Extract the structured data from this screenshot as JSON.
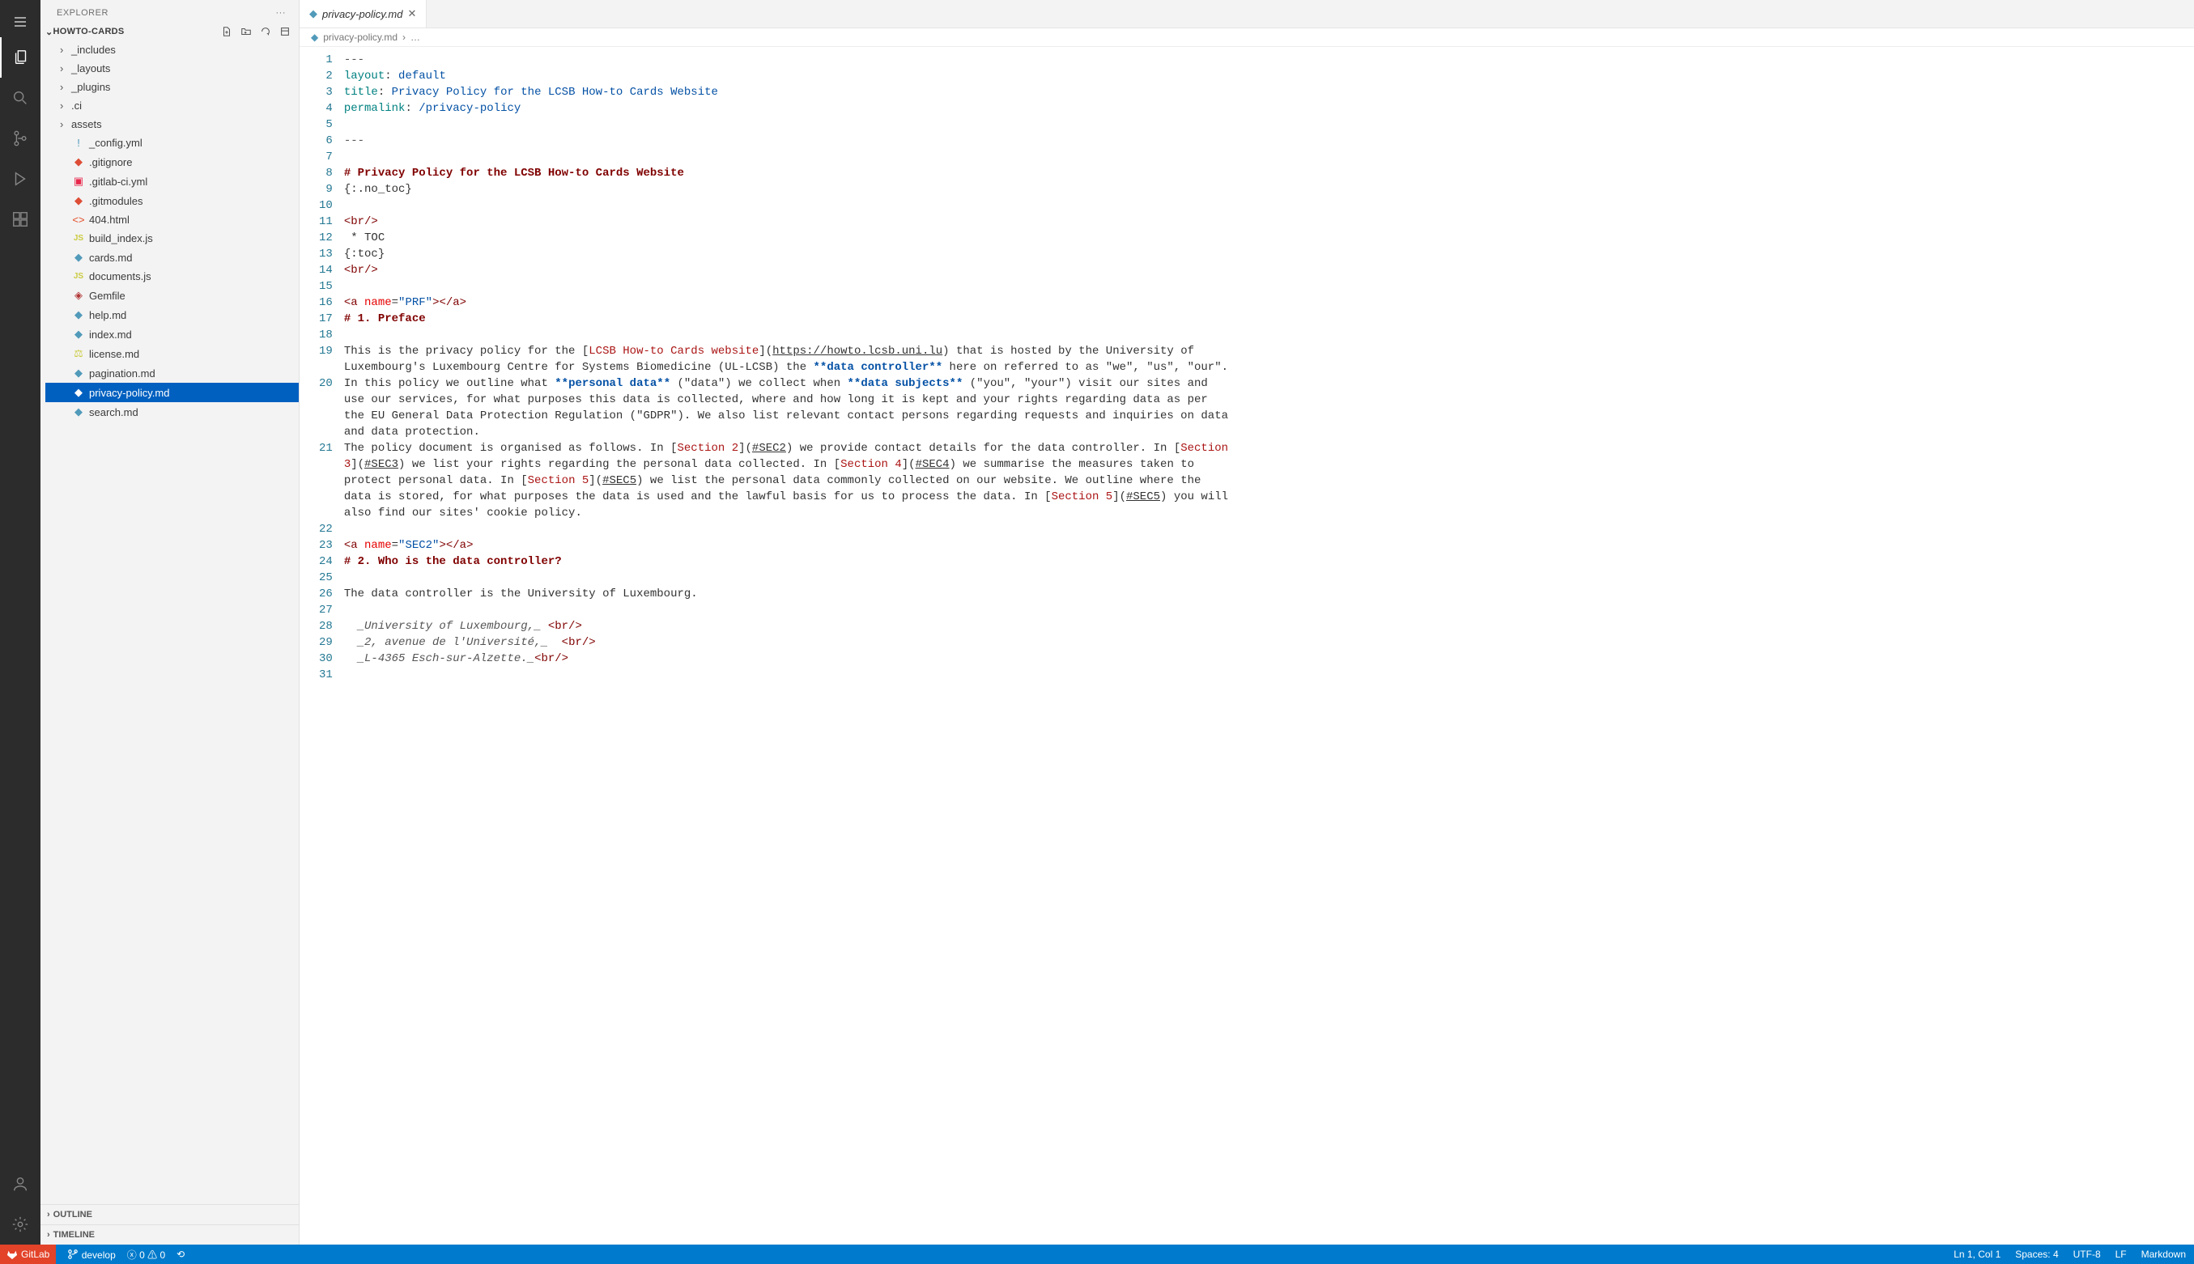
{
  "sidebar": {
    "title": "EXPLORER",
    "project": "HOWTO-CARDS",
    "folders": [
      "_includes",
      "_layouts",
      "_plugins",
      ".ci",
      "assets"
    ],
    "files": [
      {
        "name": "_config.yml",
        "icon": "exc"
      },
      {
        "name": ".gitignore",
        "icon": "git"
      },
      {
        "name": ".gitlab-ci.yml",
        "icon": "yml"
      },
      {
        "name": ".gitmodules",
        "icon": "git"
      },
      {
        "name": "404.html",
        "icon": "html"
      },
      {
        "name": "build_index.js",
        "icon": "js"
      },
      {
        "name": "cards.md",
        "icon": "md"
      },
      {
        "name": "documents.js",
        "icon": "js"
      },
      {
        "name": "Gemfile",
        "icon": "gem"
      },
      {
        "name": "help.md",
        "icon": "md"
      },
      {
        "name": "index.md",
        "icon": "md"
      },
      {
        "name": "license.md",
        "icon": "lic"
      },
      {
        "name": "pagination.md",
        "icon": "md"
      },
      {
        "name": "privacy-policy.md",
        "icon": "md",
        "selected": true
      },
      {
        "name": "search.md",
        "icon": "md"
      }
    ],
    "outline": "OUTLINE",
    "timeline": "TIMELINE"
  },
  "tab": {
    "name": "privacy-policy.md"
  },
  "breadcrumb": {
    "file": "privacy-policy.md",
    "more": "…"
  },
  "status": {
    "gitlab": "GitLab",
    "branch": "develop",
    "errors": "0",
    "warnings": "0",
    "ln": "Ln 1, Col 1",
    "spaces": "Spaces: 4",
    "encoding": "UTF-8",
    "eol": "LF",
    "lang": "Markdown"
  },
  "code": {
    "l1": "---",
    "l2a": "layout",
    "l2b": ": ",
    "l2c": "default",
    "l3a": "title",
    "l3b": ": ",
    "l3c": "Privacy Policy for the LCSB How-to Cards Website",
    "l4a": "permalink",
    "l4b": ": ",
    "l4c": "/privacy-policy",
    "l6": "---",
    "l8": "# Privacy Policy for the LCSB How-to Cards Website",
    "l9": "{:.no_toc}",
    "l11": "<br/>",
    "l12": " * TOC",
    "l13": "{:toc}",
    "l14": "<br/>",
    "l16a": "<a ",
    "l16b": "name",
    "l16c": "=",
    "l16d": "\"PRF\"",
    "l16e": "></a>",
    "l17": "# 1. Preface",
    "l19a": "This is the privacy policy for the [",
    "l19b": "LCSB How-to Cards website",
    "l19c": "](",
    "l19d": "https://howto.lcsb.uni.lu",
    "l19e": ") that is hosted by the University of",
    "l19f": "Luxembourg's Luxembourg Centre for Systems Biomedicine (UL-LCSB) the ",
    "l19g": "**data controller**",
    "l19h": " here on referred to as \"we\", \"us\", \"our\".",
    "l20a": "In this policy we outline what ",
    "l20b": "**personal data**",
    "l20c": " (\"data\") we collect when ",
    "l20d": "**data subjects**",
    "l20e": " (\"you\", \"your\") visit our sites and",
    "l20f": "use our services, for what purposes this data is collected, where and how long it is kept and your rights regarding data as per",
    "l20g": "the EU General Data Protection Regulation (\"GDPR\"). We also list relevant contact persons regarding requests and inquiries on data",
    "l20h": "and data protection.",
    "l21a": "The policy document is organised as follows. In [",
    "l21b": "Section 2",
    "l21c": "](",
    "l21d": "#SEC2",
    "l21e": ") we provide contact details for the data controller. In [",
    "l21f": "Section",
    "l21g": "3",
    "l21h": "](",
    "l21i": "#SEC3",
    "l21j": ") we list your rights regarding the personal data collected. In [",
    "l21k": "Section 4",
    "l21l": "](",
    "l21m": "#SEC4",
    "l21n": ") we summarise the measures taken to",
    "l21o": "protect personal data. In [",
    "l21p": "Section 5",
    "l21q": "](",
    "l21r": "#SEC5",
    "l21s": ") we list the personal data commonly collected on our website. We outline where the",
    "l21t": "data is stored, for what purposes the data is used and the lawful basis for us to process the data. In [",
    "l21u": "Section 5",
    "l21v": "](",
    "l21w": "#SEC5",
    "l21x": ") you will",
    "l21y": "also find our sites' cookie policy.",
    "l23a": "<a ",
    "l23b": "name",
    "l23c": "=",
    "l23d": "\"SEC2\"",
    "l23e": "></a>",
    "l24": "# 2. Who is the data controller?",
    "l26": "The data controller is the University of Luxembourg.",
    "l28a": "  _University of Luxembourg,_",
    "l28b": " <br/>",
    "l29a": "  _2, avenue de l'Université,_",
    "l29b": "  <br/>",
    "l30a": "  _L-4365 Esch-sur-Alzette._",
    "l30b": "<br/>"
  }
}
